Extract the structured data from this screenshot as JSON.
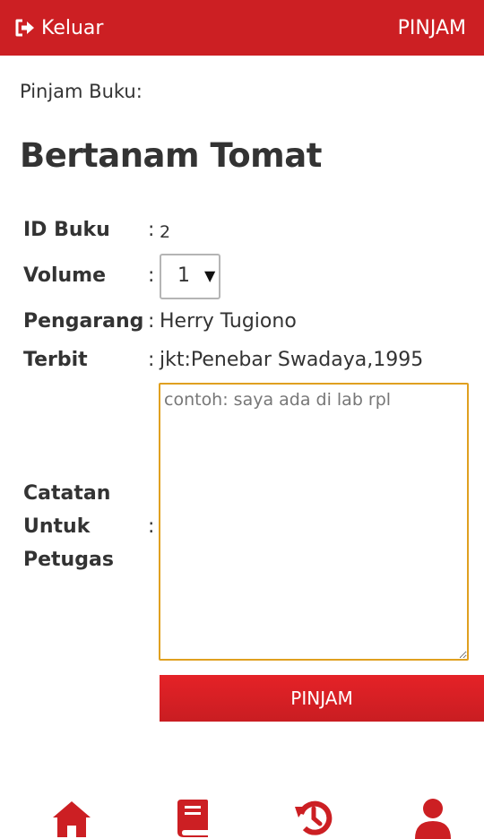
{
  "header": {
    "logout_label": "Keluar",
    "action_label": "PINJAM",
    "logout_icon": "sign-out-icon",
    "background_color": "#cc1f23"
  },
  "page": {
    "subtitle": "Pinjam Buku:",
    "book_title": "Bertanam Tomat"
  },
  "details": {
    "colon": ":",
    "id_label": "ID Buku",
    "id_value": "2",
    "volume_label": "Volume",
    "volume_selected": "1",
    "volume_arrow": "▼",
    "author_label": "Pengarang",
    "author_value": "Herry Tugiono",
    "published_label": "Terbit",
    "published_value": "jkt:Penebar Swadaya,1995"
  },
  "notes": {
    "label_line1": "Catatan",
    "label_line2": "Untuk",
    "label_line3": "Petugas",
    "placeholder": "contoh: saya ada di lab rpl",
    "value": "",
    "border_color": "#e0a020"
  },
  "submit": {
    "label": "PINJAM"
  },
  "bottom_nav": {
    "items": [
      {
        "icon": "home-icon"
      },
      {
        "icon": "book-icon"
      },
      {
        "icon": "history-icon"
      },
      {
        "icon": "user-icon"
      }
    ],
    "icon_color": "#cc1f23"
  }
}
